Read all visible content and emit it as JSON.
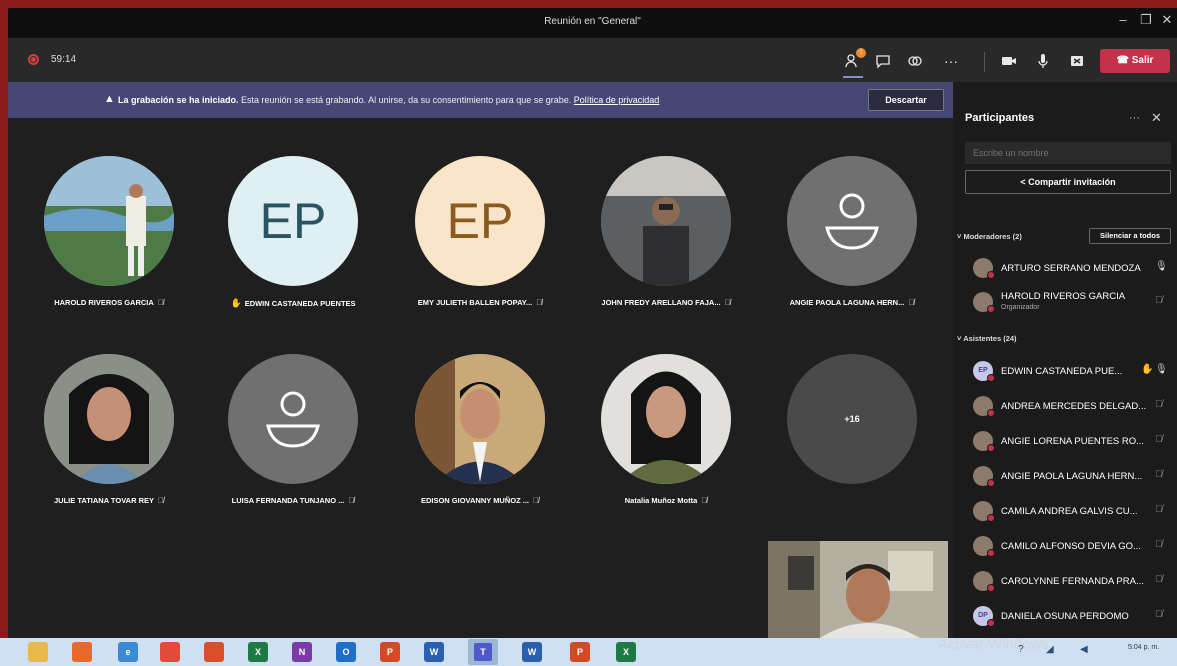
{
  "window": {
    "title": "Reunión en \"General\"",
    "controls": [
      "–",
      "❐",
      "✕"
    ]
  },
  "toolbar": {
    "timer": "59:14",
    "participants_badge": "!",
    "more": "···",
    "leave_label": "Salir",
    "leave_icon": "phone-hangup-icon"
  },
  "banner": {
    "bold": "La grabación se ha iniciado.",
    "text": " Esta reunión se está grabando. Al unirse, da su consentimiento para que se grabe. ",
    "link": "Política de privacidad",
    "dismiss": "Descartar"
  },
  "gallery": {
    "row1": [
      {
        "name": "HAROLD RIVEROS GARCIA",
        "type": "photo"
      },
      {
        "name": "EDWIN CASTANEDA PUENTES",
        "type": "initials",
        "initials": "EP",
        "hand": true
      },
      {
        "name": "EMY JULIETH BALLEN POPAY...",
        "type": "initials",
        "initials": "EP"
      },
      {
        "name": "JOHN FREDY ARELLANO FAJA...",
        "type": "photo"
      },
      {
        "name": "ANGIE PAOLA LAGUNA HERN...",
        "type": "generic"
      }
    ],
    "row2": [
      {
        "name": "JULIE TATIANA TOVAR REY",
        "type": "photo"
      },
      {
        "name": "LUISA FERNANDA TUNJANO ...",
        "type": "generic"
      },
      {
        "name": "EDISON GIOVANNY MUÑOZ ...",
        "type": "photo"
      },
      {
        "name": "Natalia Muñoz Motta",
        "type": "photo"
      },
      {
        "name": "",
        "type": "more",
        "count": "+16"
      }
    ],
    "colors": {
      "ep1_bg": "#dfeff3",
      "ep1_fg": "#2a5560",
      "ep2_bg": "#fbe5c9",
      "ep2_fg": "#8a5a1f"
    }
  },
  "panel": {
    "title": "Participantes",
    "search_placeholder": "Escribe un nombre",
    "share": "Compartir invitación",
    "moderators_label": "Moderadores (2)",
    "mute_all": "Silenciar a todos",
    "attendees_label": "Asistentes (24)",
    "moderators": [
      {
        "name": "ARTURO SERRANO MENDOZA",
        "mic": "on"
      },
      {
        "name": "HAROLD RIVEROS GARCIA",
        "sub": "Organizador",
        "mic": "off"
      }
    ],
    "attendees": [
      {
        "name": "EDWIN CASTANEDA PUE...",
        "initials": "EP",
        "hand": true,
        "mic": "on"
      },
      {
        "name": "ANDREA MERCEDES DELGAD...",
        "mic": "off"
      },
      {
        "name": "ANGIE LORENA PUENTES RO...",
        "mic": "off"
      },
      {
        "name": "ANGIE PAOLA LAGUNA HERN...",
        "mic": "off"
      },
      {
        "name": "CAMILA ANDREA GALVIS CU...",
        "mic": "off"
      },
      {
        "name": "CAMILO ALFONSO DEVIA GO...",
        "mic": "off"
      },
      {
        "name": "CAROLYNNE FERNANDA PRA...",
        "mic": "off"
      },
      {
        "name": "DANIELA OSUNA PERDOMO",
        "initials": "DP",
        "mic": "off"
      }
    ]
  },
  "taskbar": {
    "watermark": "Activar Windows",
    "time": "5:04 p. m.",
    "apps": [
      {
        "label": "",
        "color": "#e8b84a",
        "icon": "file-explorer-icon"
      },
      {
        "label": "",
        "color": "#e86a2a",
        "icon": "firefox-icon"
      },
      {
        "label": "e",
        "color": "#3a8ad8",
        "icon": "edge-icon"
      },
      {
        "label": "",
        "color": "#e64a3a",
        "icon": "chrome-icon"
      },
      {
        "label": "",
        "color": "#d8502a",
        "icon": "firefox-icon-2"
      },
      {
        "label": "X",
        "color": "#1e7a45",
        "icon": "excel-icon"
      },
      {
        "label": "N",
        "color": "#7a3aa8",
        "icon": "onenote-icon"
      },
      {
        "label": "O",
        "color": "#1f6fc8",
        "icon": "outlook-icon"
      },
      {
        "label": "P",
        "color": "#d24b25",
        "icon": "powerpoint-icon"
      },
      {
        "label": "W",
        "color": "#2b5fb2",
        "icon": "word-icon"
      },
      {
        "label": "T",
        "color": "#5059c9",
        "icon": "teams-icon"
      },
      {
        "label": "W",
        "color": "#2b5fb2",
        "icon": "word-icon-2"
      },
      {
        "label": "P",
        "color": "#d24b25",
        "icon": "powerpoint-icon-2"
      },
      {
        "label": "X",
        "color": "#1e7a45",
        "icon": "excel-icon-2"
      }
    ]
  }
}
